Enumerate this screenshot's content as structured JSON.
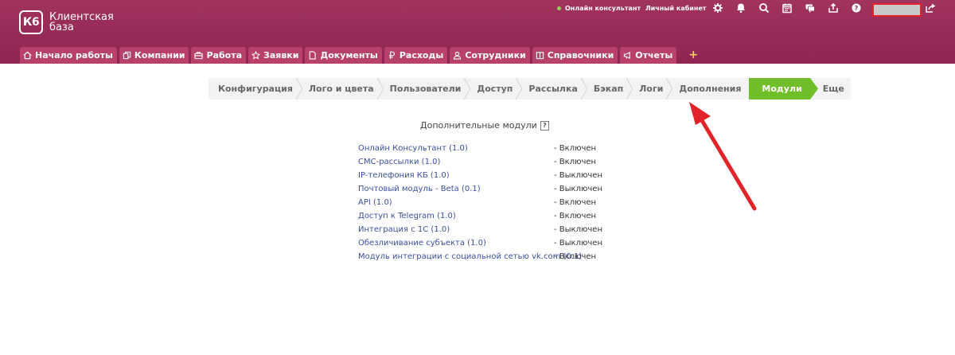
{
  "app": {
    "logo_mark": "К6",
    "logo_line1": "Клиентская",
    "logo_line2": "база"
  },
  "topbar": {
    "online_label": "Онлайн консультант",
    "cabinet_label": "Личный кабинет",
    "icons": [
      "gear-icon",
      "bell-icon",
      "search-icon",
      "calendar-icon",
      "chat-icon",
      "upload-icon",
      "help-icon",
      "logout-icon"
    ],
    "online_color": "#8fd45a"
  },
  "nav": {
    "tabs": [
      {
        "label": "Начало работы",
        "icon": "home-icon"
      },
      {
        "label": "Компании",
        "icon": "companies-icon"
      },
      {
        "label": "Работа",
        "icon": "work-icon"
      },
      {
        "label": "Заявки",
        "icon": "star-icon"
      },
      {
        "label": "Документы",
        "icon": "document-icon"
      },
      {
        "label": "Расходы",
        "icon": "expenses-icon"
      },
      {
        "label": "Сотрудники",
        "icon": "employees-icon"
      },
      {
        "label": "Справочники",
        "icon": "book-icon"
      },
      {
        "label": "Отчеты",
        "icon": "megaphone-icon"
      }
    ],
    "add_label": "+"
  },
  "settings_steps": {
    "items": [
      "Конфигурация",
      "Лого и цвета",
      "Пользователи",
      "Доступ",
      "Рассылка",
      "Бэкап",
      "Логи",
      "Дополнения",
      "Модули",
      "Еще"
    ],
    "active_index": 8,
    "active_color": "#6fbe2a"
  },
  "modules": {
    "title": "Дополнительные модули",
    "help_label": "?",
    "rows": [
      {
        "name": "Онлайн Консультант (1.0)",
        "status": "- Включен"
      },
      {
        "name": "СМС-рассылки (1.0)",
        "status": "- Включен"
      },
      {
        "name": "IP-телефония КБ (1.0)",
        "status": "- Выключен"
      },
      {
        "name": "Почтовый модуль - Beta (0.1)",
        "status": "- Выключен"
      },
      {
        "name": "API (1.0)",
        "status": "- Включен"
      },
      {
        "name": "Доступ к Telegram (1.0)",
        "status": "- Включен"
      },
      {
        "name": "Интеграция с 1С (1.0)",
        "status": "- Выключен"
      },
      {
        "name": "Обезличивание субъекта (1.0)",
        "status": "- Выключен"
      },
      {
        "name": "Модуль интеграции с социальной сетью vk.com (0.1)",
        "status": "- Включен"
      }
    ]
  },
  "colors": {
    "header": "#962a56",
    "tab": "#b8416c",
    "link": "#3b4fa0",
    "annotation_arrow": "#e0242a"
  }
}
